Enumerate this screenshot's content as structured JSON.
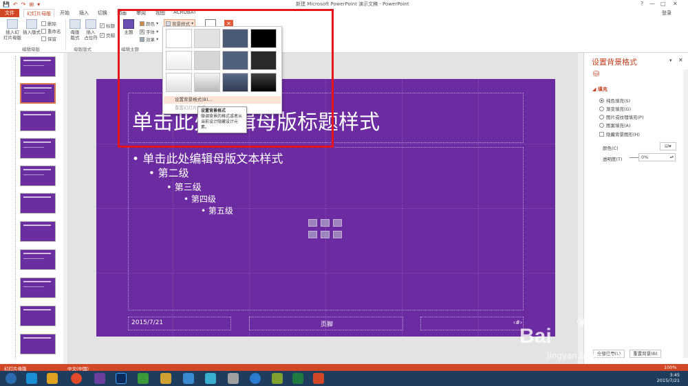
{
  "window": {
    "title": "新建 Microsoft PowerPoint 演示文稿 - PowerPoint",
    "help": "?",
    "minimize": "—",
    "restore": "□",
    "close": "✕",
    "signin": "登录"
  },
  "qat": [
    "💾",
    "↶",
    "↷",
    "⊞",
    "▾"
  ],
  "tabs": [
    "文件",
    "幻灯片母版",
    "开始",
    "插入",
    "切换",
    "动画",
    "审阅",
    "视图",
    "ACROBAT"
  ],
  "ribbon": {
    "insert_master": "插入幻\n灯片母版",
    "insert_layout": "插入版式",
    "delete": "删除",
    "rename": "重命名",
    "preserve": "保留",
    "master_layout": "母版\n版式",
    "insert_placeholder": "插入\n占位符",
    "title_check": "标题",
    "footer_check": "页脚",
    "themes": "主题",
    "colors": "颜色",
    "fonts": "字体",
    "effects": "效果",
    "bg_styles": "背景样式",
    "group_edit_master": "编辑母版",
    "group_master_layout": "母版版式",
    "group_edit_theme": "编辑主题",
    "close_icon": "✕"
  },
  "bg_menu": {
    "item_format": "设置背景格式(B)...",
    "item_reset": "重置幻灯片背景",
    "swatches": [
      [
        "#ffffff",
        "#e2e2e2",
        "#4a5a75",
        "#000000"
      ],
      [
        "#f2f2f2",
        "#d6d6d6",
        "#51617d",
        "#2a2a2a"
      ],
      [
        "#ebebeb",
        "#c8c8c8",
        "#3f4d66",
        "#1a1a1a"
      ]
    ]
  },
  "tooltip": {
    "title": "设置背景格式",
    "body": "微调背景的格式或者从当前设计隐藏设计元素。"
  },
  "slide": {
    "title": "单击此处编辑母版标题样式",
    "level1": "• 单击此处编辑母版文本样式",
    "level2": "• 第二级",
    "level3": "• 第三级",
    "level4": "• 第四级",
    "level5": "• 第五级",
    "date": "2015/7/21",
    "footer": "页脚",
    "page_num": "‹#›",
    "bg_color": "#6c2ba0"
  },
  "format_pane": {
    "title": "设置背景格式",
    "close": "✕",
    "pin": "▾",
    "section": "◢ 填充",
    "solid": "纯色填充(S)",
    "gradient": "渐变填充(G)",
    "picture": "图片或纹理填充(P)",
    "pattern": "图案填充(A)",
    "hide_graphics": "隐藏背景图形(H)",
    "color_label": "颜色(C)",
    "transparency_label": "透明度(T)",
    "transparency_value": "0%",
    "apply_all": "全部应用(L)",
    "reset": "重置背景(B)"
  },
  "statusbar": {
    "mode": "幻灯片母版",
    "lang": "中文(中国)",
    "zoom": "100%"
  },
  "taskbar": {
    "time": "3:45",
    "date": "2015/7/21"
  },
  "watermark": {
    "brand": "Bai",
    "brand_cn": "经验",
    "url": "jingyan.baidu.com"
  }
}
